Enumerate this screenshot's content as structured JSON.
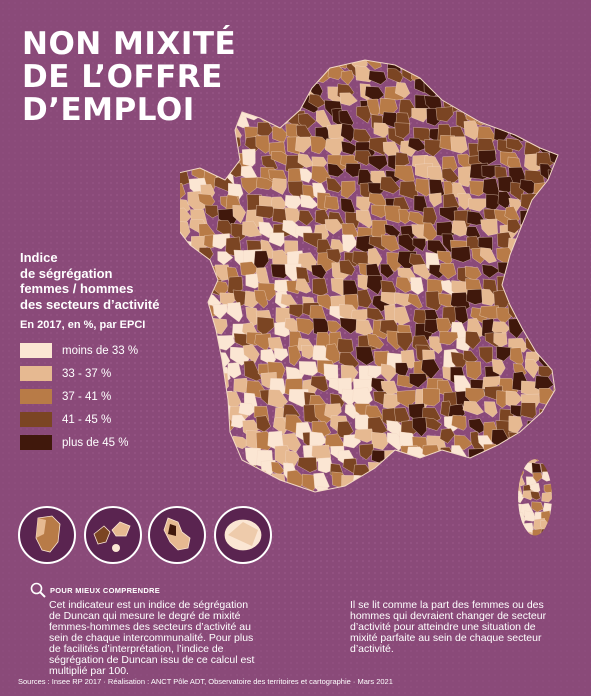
{
  "title_lines": [
    "NON MIXITÉ",
    "DE L’OFFRE",
    "D’EMPLOI"
  ],
  "legend": {
    "title_lines": [
      "Indice",
      "de ségrégation",
      "femmes / hommes",
      "des secteurs d’activité"
    ],
    "subtitle": "En 2017, en %, par EPCI",
    "items": [
      {
        "label": "moins de 33 %",
        "color": "#fbe6d3"
      },
      {
        "label": "33 - 37 %",
        "color": "#e6b991"
      },
      {
        "label": "37 - 41 %",
        "color": "#b87b47"
      },
      {
        "label": "41 - 45 %",
        "color": "#7b4523"
      },
      {
        "label": "plus de 45 %",
        "color": "#40180c"
      }
    ]
  },
  "note": {
    "heading": "POUR MIEUX COMPRENDRE",
    "col1": "Cet indicateur est un indice de ségrégation de Duncan qui mesure le degré de mixité femmes-hommes des secteurs d’activité au sein de chaque intercommunalité. Pour plus de facilités d’interprétation, l’indice de ségrégation de Duncan issu de ce calcul est multiplié par 100.",
    "col2": "Il se lit comme la part des femmes ou des hommes qui devraient changer de secteur d’activité pour atteindre une situation de mixité parfaite au sein de chaque secteur d’activité."
  },
  "sources": "Sources : Insee RP 2017 · Réalisation : ANCT Pôle ADT, Observatoire des territoires et cartographie · Mars 2021",
  "colors": {
    "background": "#8a4a79",
    "inset_bg": "#5a2450"
  }
}
